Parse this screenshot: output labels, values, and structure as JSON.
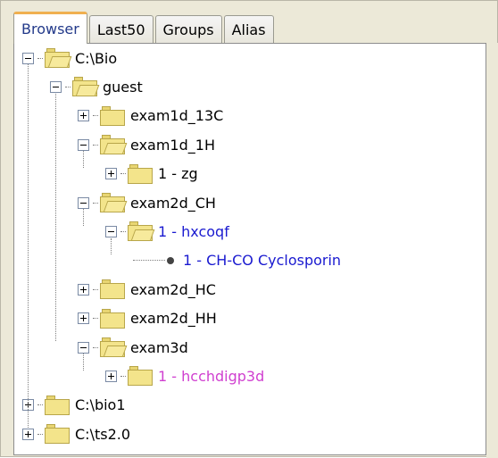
{
  "tabs": [
    {
      "label": "Browser",
      "active": true
    },
    {
      "label": "Last50",
      "active": false
    },
    {
      "label": "Groups",
      "active": false
    },
    {
      "label": "Alias",
      "active": false
    }
  ],
  "colors": {
    "default_text": "#000000",
    "blue_item": "#1a1ad0",
    "magenta_item": "#d040d0",
    "active_tab_text": "#233a8a"
  },
  "tree": [
    {
      "label": "C:\\Bio",
      "depth": 0,
      "expander": "minus",
      "icon": "folder-open-icon",
      "color": "#000000"
    },
    {
      "label": "guest",
      "depth": 1,
      "expander": "minus",
      "icon": "folder-open-icon",
      "color": "#000000"
    },
    {
      "label": "exam1d_13C",
      "depth": 2,
      "expander": "plus",
      "icon": "folder-closed-icon",
      "color": "#000000"
    },
    {
      "label": "exam1d_1H",
      "depth": 2,
      "expander": "minus",
      "icon": "folder-open-icon",
      "color": "#000000"
    },
    {
      "label": "1 - zg",
      "depth": 3,
      "expander": "plus",
      "icon": "folder-closed-icon",
      "color": "#000000"
    },
    {
      "label": "exam2d_CH",
      "depth": 2,
      "expander": "minus",
      "icon": "folder-open-icon",
      "color": "#000000"
    },
    {
      "label": "1 - hxcoqf",
      "depth": 3,
      "expander": "minus",
      "icon": "folder-open-icon",
      "color": "#1a1ad0"
    },
    {
      "label": "1 - CH-CO Cyclosporin",
      "depth": 4,
      "expander": "none",
      "icon": "leaf-dot-icon",
      "color": "#1a1ad0"
    },
    {
      "label": "exam2d_HC",
      "depth": 2,
      "expander": "plus",
      "icon": "folder-closed-icon",
      "color": "#000000"
    },
    {
      "label": "exam2d_HH",
      "depth": 2,
      "expander": "plus",
      "icon": "folder-closed-icon",
      "color": "#000000"
    },
    {
      "label": "exam3d",
      "depth": 2,
      "expander": "minus",
      "icon": "folder-open-icon",
      "color": "#000000"
    },
    {
      "label": "1 - hcchdigp3d",
      "depth": 3,
      "expander": "plus",
      "icon": "folder-closed-icon",
      "color": "#d040d0"
    },
    {
      "label": "C:\\bio1",
      "depth": 0,
      "expander": "plus",
      "icon": "folder-closed-icon",
      "color": "#000000"
    },
    {
      "label": "C:\\ts2.0",
      "depth": 0,
      "expander": "plus",
      "icon": "folder-closed-icon",
      "color": "#000000"
    }
  ]
}
